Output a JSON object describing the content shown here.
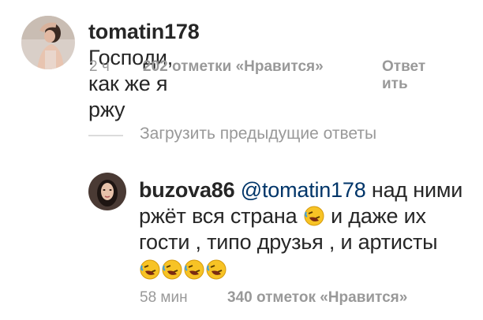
{
  "comment1": {
    "username": "tomatin178",
    "text": "Господи, как же я ржу",
    "time": "2 ч",
    "likes": "202 отметки «Нравится»",
    "reply_line1": "Ответ",
    "reply_line2": "ить"
  },
  "load_previous": "Загрузить предыдущие ответы",
  "comment2": {
    "username": "buzova86",
    "mention": "@tomatin178",
    "text_part1": "над ними",
    "text_part2": "ржёт вся страна",
    "text_part3": "и даже их",
    "text_part4": "гости , типо друзья , и артисты",
    "time": "58 мин",
    "likes": "340 отметок «Нравится»"
  },
  "icons": {
    "emoji": "rolling-on-floor-laughing-emoji"
  }
}
